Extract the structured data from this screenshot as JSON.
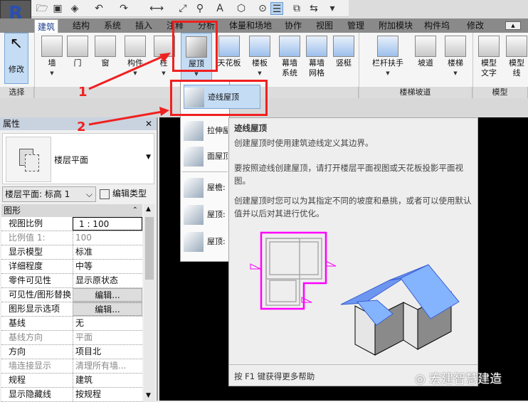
{
  "app": {
    "logo": "R"
  },
  "qat": {
    "icons": [
      "open-icon",
      "save-icon",
      "sync-icon",
      "undo-icon",
      "redo-icon",
      "measure-icon",
      "dimension-icon",
      "tag-icon",
      "text-icon",
      "3d-view-icon",
      "section-icon",
      "thin-lines-icon",
      "close-hidden-icon",
      "switch-windows-icon",
      "customize-icon"
    ],
    "text_glyph": "A"
  },
  "tabs": [
    {
      "label": "建筑",
      "active": true
    },
    {
      "label": "结构"
    },
    {
      "label": "系统"
    },
    {
      "label": "插入"
    },
    {
      "label": "注释"
    },
    {
      "label": "分析"
    },
    {
      "label": "体量和场地"
    },
    {
      "label": "协作"
    },
    {
      "label": "视图"
    },
    {
      "label": "管理"
    },
    {
      "label": "附加模块"
    },
    {
      "label": "构件坞"
    },
    {
      "label": "修改"
    }
  ],
  "ribbon": {
    "buttons": [
      {
        "label": "修改"
      },
      {
        "label": "墙"
      },
      {
        "label": "门"
      },
      {
        "label": "窗"
      },
      {
        "label": "构件"
      },
      {
        "label": "柱"
      },
      {
        "label": "屋顶"
      },
      {
        "label": "天花板"
      },
      {
        "label": "楼板"
      },
      {
        "label": "幕墙\n系统"
      },
      {
        "label": "幕墙\n网格"
      },
      {
        "label": "竖梃"
      },
      {
        "label": "栏杆扶手"
      },
      {
        "label": "坡道"
      },
      {
        "label": "楼梯"
      },
      {
        "label": "模型\n文字"
      },
      {
        "label": "模型\n线"
      }
    ],
    "panels": {
      "select": "选择",
      "stairs": "楼梯坡道",
      "model": "模型"
    }
  },
  "annotations": {
    "one": "1",
    "two": "2",
    "color": "#f02020"
  },
  "roof_menu": {
    "items": [
      "迹线屋顶",
      "拉伸屋",
      "面屋顶",
      "屋檐:",
      "屋顶:",
      "屋顶:"
    ]
  },
  "properties": {
    "title": "属性",
    "type_name": "楼层平面",
    "instance_select": "楼层平面: 标高 1",
    "edit_type": "编辑类型",
    "group": "图形",
    "rows": [
      {
        "k": "视图比例",
        "v": "1 : 100"
      },
      {
        "k": "比例值 1:",
        "v": "100",
        "dim": true
      },
      {
        "k": "显示模型",
        "v": "标准"
      },
      {
        "k": "详细程度",
        "v": "中等"
      },
      {
        "k": "零件可见性",
        "v": "显示原状态"
      },
      {
        "k": "可见性/图形替换",
        "v": "编辑...",
        "button": true
      },
      {
        "k": "图形显示选项",
        "v": "编辑...",
        "button": true
      },
      {
        "k": "基线",
        "v": "无"
      },
      {
        "k": "基线方向",
        "v": "平面",
        "dim": true
      },
      {
        "k": "方向",
        "v": "项目北"
      },
      {
        "k": "墙连接显示",
        "v": "清理所有墙...",
        "dim": true
      },
      {
        "k": "规程",
        "v": "建筑"
      },
      {
        "k": "显示隐藏线",
        "v": "按规程"
      }
    ]
  },
  "tooltip": {
    "title": "迹线屋顶",
    "p1": "创建屋顶时使用建筑迹线定义其边界。",
    "p2": "要按照迹线创建屋顶，请打开楼层平面视图或天花板投影平面视图。",
    "p3": "创建屋顶时您可以为其指定不同的坡度和悬挑，或者可以使用默认值并以后对其进行优化。",
    "footer": "按 F1 键获得更多帮助",
    "colors": {
      "footprint": "#ff00ff",
      "roof": "#7fb0ff"
    }
  },
  "watermark": "宏建智慧建造"
}
